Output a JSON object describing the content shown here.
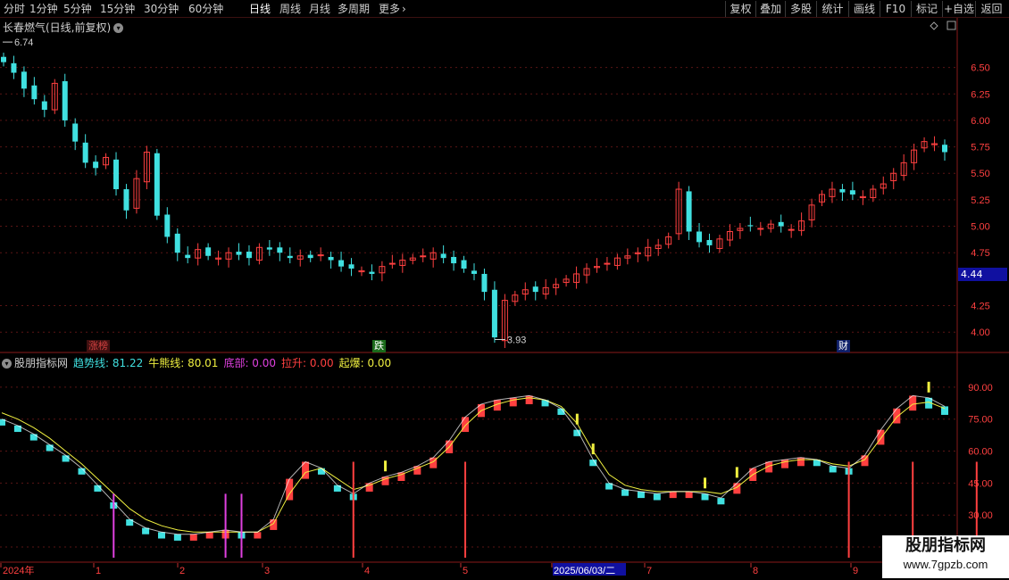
{
  "toolbar": {
    "periods": [
      "分时",
      "1分钟",
      "5分钟",
      "15分钟",
      "30分钟",
      "60分钟",
      "日线",
      "周线",
      "月线",
      "多周期",
      "更多"
    ],
    "active_period": "日线",
    "more_icon": "chevron-right-icon",
    "buttons": [
      "复权",
      "叠加",
      "多股",
      "统计",
      "画线",
      "F10",
      "标记",
      "+自选",
      "返回"
    ]
  },
  "main_panel": {
    "title": "长春燃气(日线,前复权)",
    "high_label": "6.74",
    "low_label": "3.93",
    "current_price": "4.44",
    "price_ticks": [
      "6.50",
      "6.25",
      "6.00",
      "5.75",
      "5.50",
      "5.25",
      "5.00",
      "4.75",
      "4.25",
      "4.00"
    ],
    "events": [
      {
        "label": "涨榜",
        "color": "#d04040"
      },
      {
        "label": "跌",
        "color": "#20a020"
      },
      {
        "label": "财",
        "color": "#3060c0"
      }
    ]
  },
  "indicator_panel": {
    "name": "股朋指标网",
    "items": [
      {
        "label": "趋势线:",
        "value": "81.22",
        "color": "#40e0e0"
      },
      {
        "label": "牛熊线:",
        "value": "80.01",
        "color": "#f0f040"
      },
      {
        "label": "底部:",
        "value": "0.00",
        "color": "#e040e0"
      },
      {
        "label": "拉升:",
        "value": "0.00",
        "color": "#ff4040"
      },
      {
        "label": "起爆:",
        "value": "0.00",
        "color": "#f0f040"
      }
    ],
    "ticks": [
      "90.00",
      "75.00",
      "60.00",
      "45.00",
      "30.00",
      "15.00"
    ]
  },
  "x_axis": {
    "labels": [
      "2024年",
      "1",
      "2",
      "3",
      "4",
      "5",
      "2025/06/03/二",
      "7",
      "8",
      "9"
    ]
  },
  "watermark": {
    "line1": "股朋指标网",
    "line2": "www.7gpzb.com"
  },
  "colors": {
    "up": "#ff4040",
    "down": "#40e0e0",
    "bull_bear": "#f0f040",
    "bottom": "#e040e0",
    "grid": "#5a1414",
    "axis_text": "#ff4040"
  },
  "chart_data": [
    {
      "type": "candlestick",
      "title": "长春燃气(日线,前复权)",
      "ylim": [
        3.85,
        6.8
      ],
      "yticks": [
        4.0,
        4.25,
        4.75,
        5.0,
        5.25,
        5.5,
        5.75,
        6.0,
        6.25,
        6.5
      ],
      "close_series": [
        6.55,
        6.45,
        6.3,
        6.2,
        6.1,
        6.35,
        6.0,
        5.8,
        5.6,
        5.55,
        5.65,
        5.35,
        5.15,
        5.45,
        5.7,
        5.1,
        4.9,
        4.75,
        4.7,
        4.78,
        4.72,
        4.7,
        4.75,
        4.73,
        4.7,
        4.8,
        4.78,
        4.75,
        4.7,
        4.72,
        4.7,
        4.73,
        4.68,
        4.62,
        4.6,
        4.58,
        4.55,
        4.62,
        4.65,
        4.68,
        4.7,
        4.72,
        4.75,
        4.7,
        4.65,
        4.6,
        4.55,
        4.38,
        3.95,
        4.3,
        4.35,
        4.4,
        4.38,
        4.42,
        4.45,
        4.5,
        4.55,
        4.6,
        4.62,
        4.65,
        4.7,
        4.72,
        4.75,
        4.8,
        4.82,
        4.9,
        5.35,
        4.95,
        4.85,
        4.82,
        4.88,
        4.95,
        4.98,
        5.0,
        4.98,
        5.02,
        5.0,
        4.97,
        5.05,
        5.2,
        5.3,
        5.35,
        5.32,
        5.3,
        5.28,
        5.35,
        5.4,
        5.5,
        5.6,
        5.72,
        5.8,
        5.78,
        5.7
      ],
      "high": 6.74,
      "low": 3.93,
      "current": 4.44
    },
    {
      "type": "line",
      "title": "股朋指标网",
      "ylim": [
        10,
        100
      ],
      "yticks": [
        15,
        30,
        45,
        60,
        75,
        90
      ],
      "series": [
        {
          "name": "趋势线",
          "values": [
            75,
            72,
            68,
            63,
            58,
            52,
            44,
            36,
            28,
            24,
            22,
            21,
            21,
            22,
            23,
            22,
            22,
            28,
            47,
            55,
            52,
            44,
            40,
            45,
            48,
            50,
            53,
            57,
            65,
            76,
            82,
            84,
            85,
            86,
            84,
            80,
            70,
            56,
            45,
            42,
            41,
            40,
            41,
            41,
            40,
            38,
            45,
            52,
            55,
            56,
            57,
            56,
            53,
            52,
            58,
            70,
            80,
            86,
            85,
            81
          ]
        },
        {
          "name": "牛熊线",
          "values": [
            78,
            75,
            71,
            66,
            60,
            54,
            47,
            40,
            33,
            28,
            25,
            23,
            22,
            22,
            22,
            22,
            22,
            26,
            40,
            50,
            52,
            47,
            42,
            44,
            47,
            49,
            52,
            55,
            62,
            72,
            79,
            82,
            84,
            85,
            84,
            81,
            73,
            60,
            49,
            44,
            42,
            41,
            41,
            41,
            41,
            40,
            43,
            49,
            53,
            55,
            56,
            56,
            54,
            53,
            56,
            66,
            76,
            82,
            83,
            80
          ]
        }
      ],
      "signals": {
        "底部": [
          7,
          14,
          15
        ],
        "拉升": [
          22,
          29,
          53,
          57,
          61,
          64
        ],
        "起爆": [
          24,
          36,
          37,
          44,
          46,
          58,
          67,
          69,
          70
        ]
      }
    }
  ]
}
